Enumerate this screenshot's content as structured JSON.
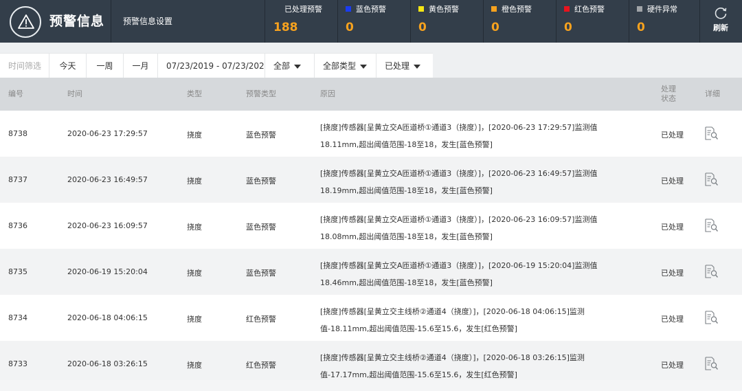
{
  "header": {
    "app_title": "预警信息",
    "settings_label": "预警信息设置",
    "refresh_label": "刷新",
    "stats": [
      {
        "label": "已处理预警",
        "value": "188",
        "color": ""
      },
      {
        "label": "蓝色预警",
        "value": "0",
        "color": "#1a3cf0"
      },
      {
        "label": "黄色预警",
        "value": "0",
        "color": "#f5e614"
      },
      {
        "label": "橙色预警",
        "value": "0",
        "color": "#f7a21e"
      },
      {
        "label": "红色预警",
        "value": "0",
        "color": "#e8141e"
      },
      {
        "label": "硬件异常",
        "value": "0",
        "color": "#a0a4a8"
      }
    ]
  },
  "filters": {
    "time_label": "时间筛选",
    "today": "今天",
    "week": "一周",
    "month": "一月",
    "date_range": "07/23/2019 - 07/23/202",
    "scope": "全部",
    "type": "全部类型",
    "status": "已处理"
  },
  "table": {
    "columns": [
      "编号",
      "时间",
      "类型",
      "预警类型",
      "原因",
      "处理状态",
      "详细"
    ],
    "rows": [
      {
        "id": "8738",
        "time": "2020-06-23 17:29:57",
        "type": "挠度",
        "alert": "蓝色预警",
        "reason": "[挠度]传感器[呈黄立交A匝道桥①通道3（挠度）]，[2020-06-23 17:29:57]监测值18.11mm,超出阈值范围-18至18，发生[蓝色预警]",
        "status": "已处理"
      },
      {
        "id": "8737",
        "time": "2020-06-23 16:49:57",
        "type": "挠度",
        "alert": "蓝色预警",
        "reason": "[挠度]传感器[呈黄立交A匝道桥①通道3（挠度）]，[2020-06-23 16:49:57]监测值18.19mm,超出阈值范围-18至18，发生[蓝色预警]",
        "status": "已处理"
      },
      {
        "id": "8736",
        "time": "2020-06-23 16:09:57",
        "type": "挠度",
        "alert": "蓝色预警",
        "reason": "[挠度]传感器[呈黄立交A匝道桥①通道3（挠度）]，[2020-06-23 16:09:57]监测值18.08mm,超出阈值范围-18至18，发生[蓝色预警]",
        "status": "已处理"
      },
      {
        "id": "8735",
        "time": "2020-06-19 15:20:04",
        "type": "挠度",
        "alert": "蓝色预警",
        "reason": "[挠度]传感器[呈黄立交A匝道桥①通道3（挠度）]，[2020-06-19 15:20:04]监测值18.46mm,超出阈值范围-18至18，发生[蓝色预警]",
        "status": "已处理"
      },
      {
        "id": "8734",
        "time": "2020-06-18 04:06:15",
        "type": "挠度",
        "alert": "红色预警",
        "reason": "[挠度]传感器[呈黄立交主线桥②通道4（挠度）]，[2020-06-18 04:06:15]监测值-18.11mm,超出阈值范围-15.6至15.6，发生[红色预警]",
        "status": "已处理"
      },
      {
        "id": "8733",
        "time": "2020-06-18 03:26:15",
        "type": "挠度",
        "alert": "红色预警",
        "reason": "[挠度]传感器[呈黄立交主线桥②通道4（挠度）]，[2020-06-18 03:26:15]监测值-17.17mm,超出阈值范围-15.6至15.6，发生[红色预警]",
        "status": "已处理"
      }
    ]
  }
}
